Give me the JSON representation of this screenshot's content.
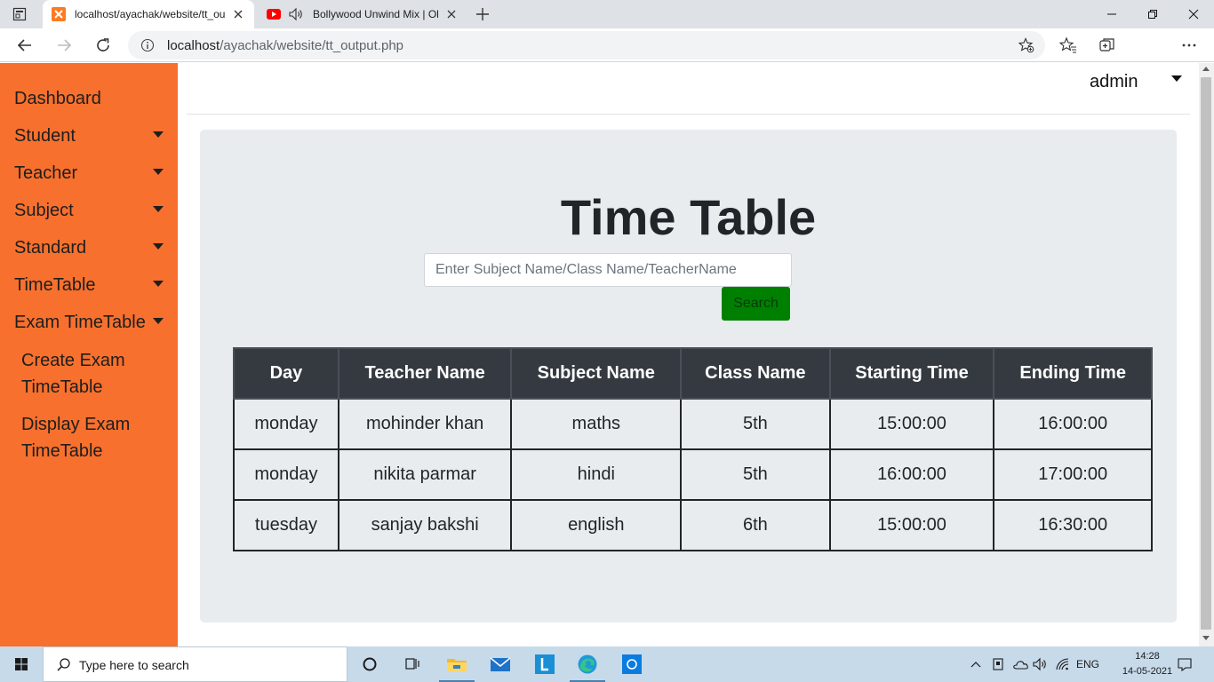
{
  "browser": {
    "tabs": [
      {
        "title": "localhost/ayachak/website/tt_ou",
        "active": true
      },
      {
        "title": "Bollywood Unwind Mix | Old",
        "active": false
      }
    ],
    "url_host": "localhost",
    "url_path": "/ayachak/website/tt_output.php"
  },
  "sidebar": {
    "items": [
      {
        "label": "Dashboard",
        "has_caret": false
      },
      {
        "label": "Student",
        "has_caret": true
      },
      {
        "label": "Teacher",
        "has_caret": true
      },
      {
        "label": "Subject",
        "has_caret": true
      },
      {
        "label": "Standard",
        "has_caret": true
      },
      {
        "label": "TimeTable",
        "has_caret": true
      },
      {
        "label": "Exam TimeTable",
        "has_caret": true
      }
    ],
    "subitems": [
      {
        "label": "Create Exam TimeTable"
      },
      {
        "label": "Display Exam TimeTable"
      }
    ]
  },
  "header": {
    "user": "admin"
  },
  "main": {
    "title": "Time Table",
    "search": {
      "placeholder": "Enter Subject Name/Class Name/TeacherName",
      "value": "",
      "button_label": "Search"
    },
    "table": {
      "headers": [
        "Day",
        "Teacher Name",
        "Subject Name",
        "Class Name",
        "Starting Time",
        "Ending Time"
      ],
      "rows": [
        [
          "monday",
          "mohinder khan",
          "maths",
          "5th",
          "15:00:00",
          "16:00:00"
        ],
        [
          "monday",
          "nikita parmar",
          "hindi",
          "5th",
          "16:00:00",
          "17:00:00"
        ],
        [
          "tuesday",
          "sanjay bakshi",
          "english",
          "6th",
          "15:00:00",
          "16:30:00"
        ]
      ]
    }
  },
  "taskbar": {
    "search_placeholder": "Type here to search",
    "language": "ENG",
    "time": "14:28",
    "date": "14-05-2021"
  },
  "colors": {
    "sidebar": "#f7702d",
    "panel": "#e9ecef",
    "table_header": "#343a40",
    "search_button": "#008000"
  }
}
